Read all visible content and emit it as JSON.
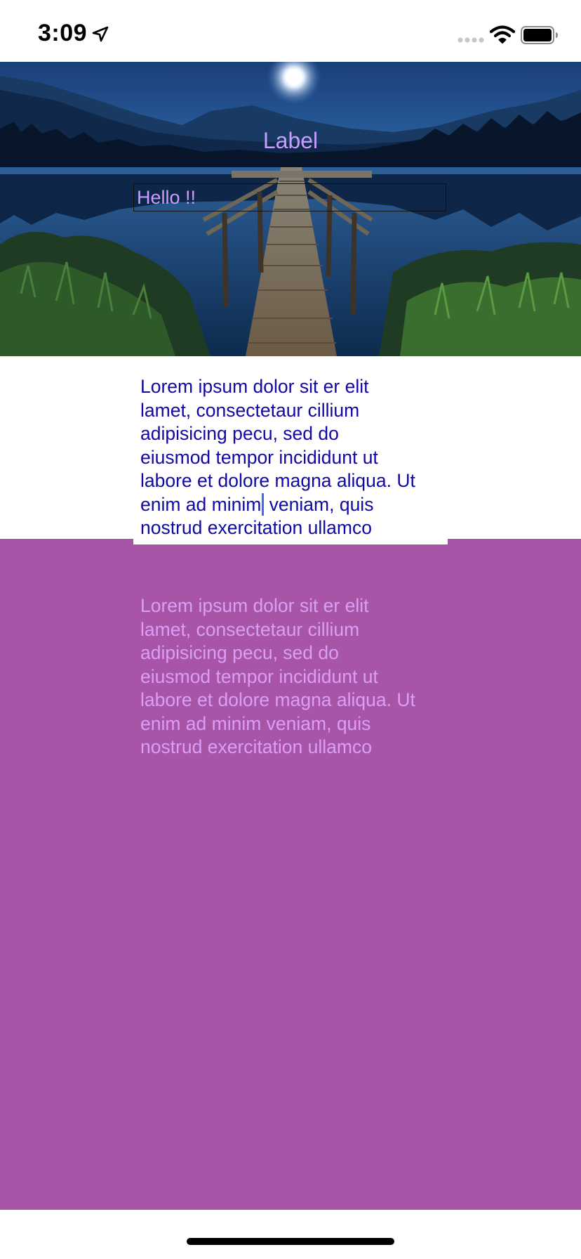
{
  "status_bar": {
    "time": "3:09"
  },
  "hero": {
    "label": "Label",
    "text_field_value": "Hello !!"
  },
  "text_view": {
    "lines": [
      "Lorem ipsum dolor sit er elit",
      "lamet, consectetaur cillium",
      "adipisicing pecu, sed do",
      "eiusmod tempor incididunt ut",
      "labore et dolore magna aliqua. Ut"
    ],
    "line6_before_caret": "enim ad minim",
    "line6_after_caret": " veniam, quis",
    "line7": "nostrud exercitation ullamco"
  },
  "purple_text": {
    "lines": [
      "Lorem ipsum dolor sit er elit",
      "lamet, consectetaur cillium",
      "adipisicing pecu, sed do",
      "eiusmod tempor incididunt ut",
      "labore et dolore magna aliqua. Ut",
      "enim ad minim veniam, quis",
      "nostrud exercitation ullamco"
    ]
  },
  "colors": {
    "purple_background": "#a855a8",
    "label_color": "#c89dff",
    "text_view_color": "#1208a3",
    "purple_text_color": "#d99ff5",
    "caret_color": "#3d6cf0"
  },
  "icons": {
    "location": "location-arrow-icon",
    "cellular": "cellular-signal-icon",
    "wifi": "wifi-icon",
    "battery": "battery-icon"
  }
}
